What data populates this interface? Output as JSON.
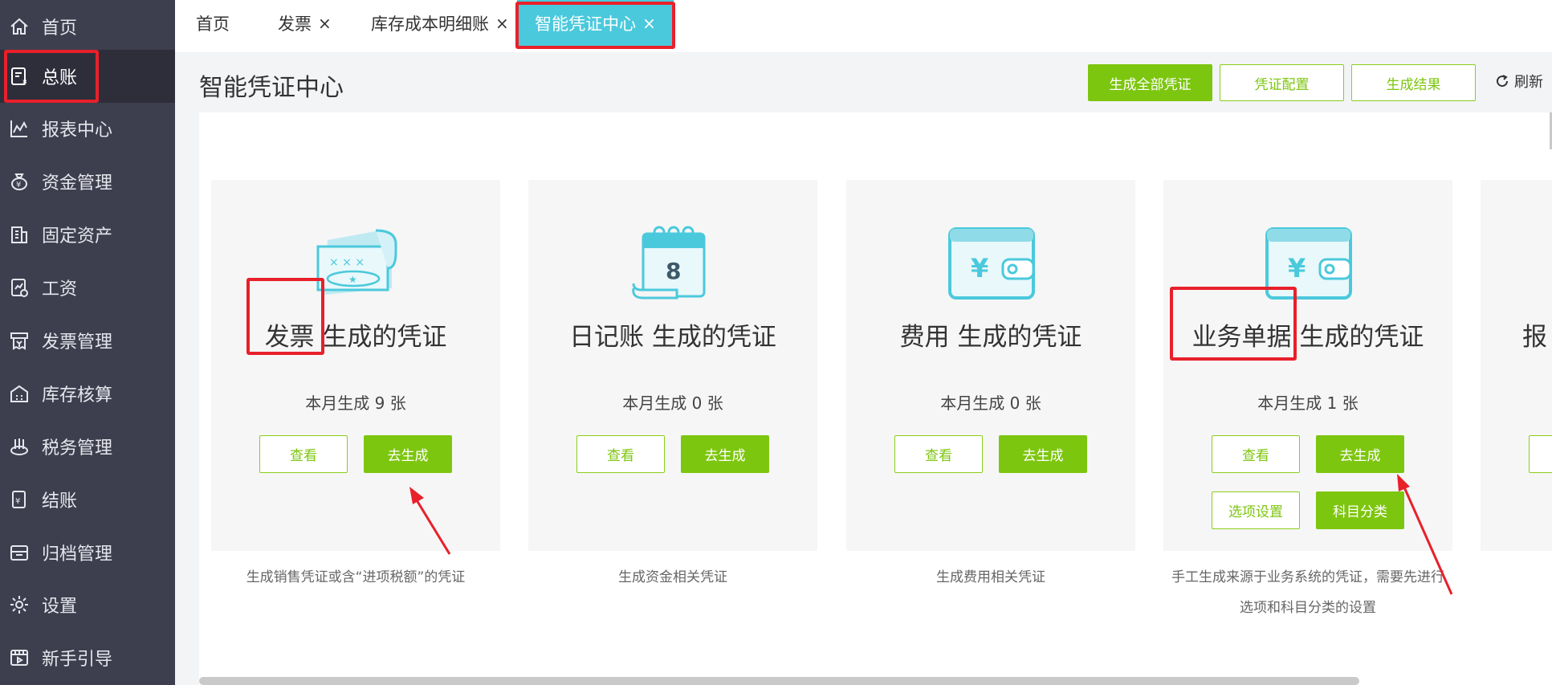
{
  "sidebar": {
    "items": [
      {
        "label": "首页",
        "icon": "home-icon"
      },
      {
        "label": "总账",
        "icon": "ledger-icon"
      },
      {
        "label": "报表中心",
        "icon": "chart-icon"
      },
      {
        "label": "资金管理",
        "icon": "money-bag-icon"
      },
      {
        "label": "固定资产",
        "icon": "building-icon"
      },
      {
        "label": "工资",
        "icon": "salary-icon"
      },
      {
        "label": "发票管理",
        "icon": "invoice-icon"
      },
      {
        "label": "库存核算",
        "icon": "warehouse-icon"
      },
      {
        "label": "税务管理",
        "icon": "tax-icon"
      },
      {
        "label": "结账",
        "icon": "checkout-icon"
      },
      {
        "label": "归档管理",
        "icon": "archive-icon"
      },
      {
        "label": "设置",
        "icon": "gear-icon"
      },
      {
        "label": "新手引导",
        "icon": "film-icon"
      }
    ],
    "active": "总账"
  },
  "tabs": [
    {
      "label": "首页",
      "closable": false
    },
    {
      "label": "发票",
      "closable": true
    },
    {
      "label": "库存成本明细账",
      "closable": true
    },
    {
      "label": "智能凭证中心",
      "closable": true,
      "active": true
    }
  ],
  "close_glyph": "×",
  "page": {
    "title": "智能凭证中心",
    "buttons": {
      "generate_all": "生成全部凭证",
      "config": "凭证配置",
      "result": "生成结果",
      "refresh": "刷新"
    }
  },
  "cards": [
    {
      "title": "发票 生成的凭证",
      "count": "本月生成 9 张",
      "view": "查看",
      "generate": "去生成",
      "desc": "生成销售凭证或含“进项税额”的凭证",
      "icon": "invoice-ticket-icon"
    },
    {
      "title": "日记账 生成的凭证",
      "count": "本月生成 0 张",
      "view": "查看",
      "generate": "去生成",
      "desc": "生成资金相关凭证",
      "icon": "calendar-icon"
    },
    {
      "title": "费用 生成的凭证",
      "count": "本月生成  0 张",
      "view": "查看",
      "generate": "去生成",
      "desc": "生成费用相关凭证",
      "icon": "wallet-icon"
    },
    {
      "title": "业务单据 生成的凭证",
      "count": "本月生成  1 张",
      "view": "查看",
      "generate": "去生成",
      "option": "选项设置",
      "subject": "科目分类",
      "desc_line1": "手工生成来源于业务系统的凭证，需要先进行",
      "desc_line2": "选项和科目分类的设置",
      "icon": "wallet-icon"
    },
    {
      "title_partial": "报"
    }
  ],
  "colors": {
    "sidebar_bg": "#3e3f4e",
    "accent_green": "#7dc60f",
    "active_tab": "#4bc9dc",
    "icon_cyan": "#4bc9dc",
    "annotation_red": "#e8202a"
  }
}
